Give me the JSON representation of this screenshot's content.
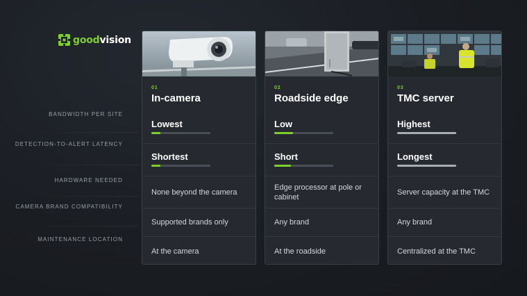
{
  "brand": {
    "logo_part1": "good",
    "logo_part2": "vision",
    "accent": "#7dcf2c"
  },
  "rows": [
    {
      "label": "BANDWIDTH PER SITE"
    },
    {
      "label": "DETECTION-TO-ALERT LATENCY"
    },
    {
      "label": "HARDWARE NEEDED"
    },
    {
      "label": "CAMERA BRAND COMPATIBILITY"
    },
    {
      "label": "MAINTENANCE LOCATION"
    }
  ],
  "cards": [
    {
      "number": "01",
      "title": "In-camera",
      "image": "security-camera-photo",
      "bandwidth": {
        "label": "Lowest",
        "level": 0.15,
        "color": "#7dcf2c"
      },
      "latency": {
        "label": "Shortest",
        "level": 0.15,
        "color": "#7dcf2c"
      },
      "hardware": "None beyond the camera",
      "compatibility": "Supported brands only",
      "maintenance": "At the camera"
    },
    {
      "number": "02",
      "title": "Roadside edge",
      "image": "roadside-cabinet-photo",
      "bandwidth": {
        "label": "Low",
        "level": 0.32,
        "color": "#7dcf2c"
      },
      "latency": {
        "label": "Short",
        "level": 0.28,
        "color": "#7dcf2c"
      },
      "hardware": "Edge processor at pole or cabinet",
      "compatibility": "Any brand",
      "maintenance": "At the roadside"
    },
    {
      "number": "03",
      "title": "TMC server",
      "image": "traffic-control-room-photo",
      "bandwidth": {
        "label": "Highest",
        "level": 1.0,
        "color": "#a8adb4"
      },
      "latency": {
        "label": "Longest",
        "level": 1.0,
        "color": "#a8adb4"
      },
      "hardware": "Server capacity at the TMC",
      "compatibility": "Any brand",
      "maintenance": "Centralized at the TMC"
    }
  ]
}
